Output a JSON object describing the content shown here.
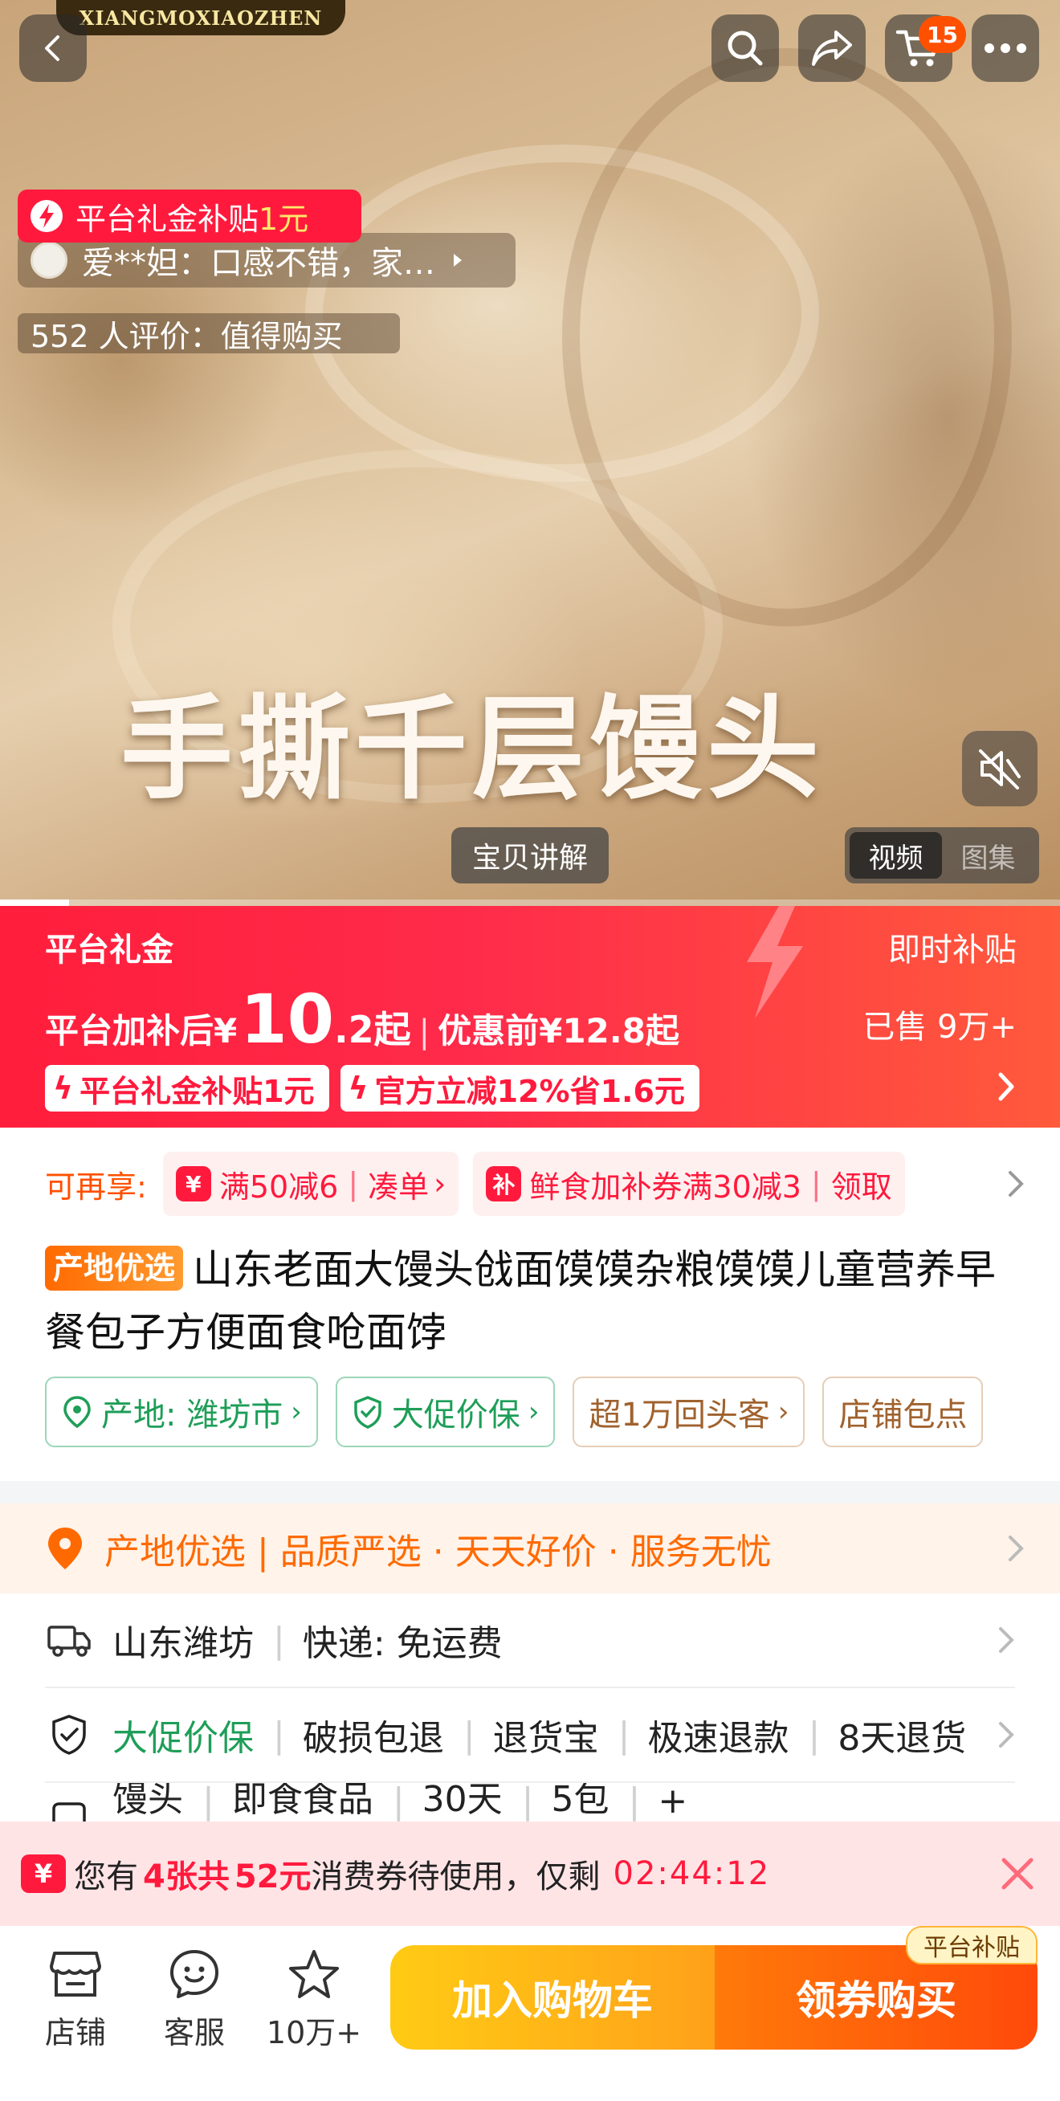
{
  "hero": {
    "brand_text": "XIANGMOXIAOZHEN",
    "cart_count": "15",
    "subsidy_chip": {
      "label": "平台礼金补贴",
      "amount": "1元"
    },
    "review_chip": "爱**妲：口感不错，家…",
    "review_count": "552 人评价：值得购买",
    "overlay_title": "手撕千层馒头",
    "explain_label": "宝贝讲解",
    "media_tabs": [
      "视频",
      "图集"
    ]
  },
  "price_banner": {
    "title": "平台礼金",
    "right_label": "即时补贴",
    "price_label": "平台加补后¥",
    "price_int": "10",
    "price_dec": ".2起",
    "prev_price": "优惠前¥12.8起",
    "sold": "已售 9万+",
    "tags": [
      "平台礼金补贴1元",
      "官方立减12%省1.6元"
    ]
  },
  "coupons": {
    "label": "可再享:",
    "items": [
      {
        "icon": "¥",
        "text": "满50减6",
        "action": "凑单"
      },
      {
        "icon": "补",
        "text": "鲜食加补券满30减3",
        "action": "领取"
      }
    ]
  },
  "product": {
    "badge": "产地优选",
    "title": "山东老面大馒头戗面馍馍杂粮馍馍儿童营养早餐包子方便面食呛面饽"
  },
  "service_tags": [
    "产地: 潍坊市",
    "大促价保",
    "超1万回头客",
    "店铺包点"
  ],
  "origin_strip": "产地优选 | 品质严选 · 天天好价 · 服务无忧",
  "info": {
    "shipping": {
      "from": "山东潍坊",
      "method": "快递: 免运费"
    },
    "guarantee": {
      "highlight": "大促价保",
      "items": [
        "破损包退",
        "退货宝",
        "极速退款",
        "8天退货"
      ]
    },
    "spec": {
      "items": [
        "馒头",
        "即食食品",
        "30天",
        "5包",
        "+"
      ]
    }
  },
  "voucher": {
    "prefix": "您有",
    "count": "4张共",
    "amount": "52元",
    "suffix": "消费券待使用，仅剩",
    "timer": "02:44:12"
  },
  "bottom_bar": {
    "store": "店铺",
    "service": "客服",
    "favorites": "10万+",
    "cart_button": "加入购物车",
    "buy_button": "领券购买",
    "subsidy_tag": "平台补贴"
  },
  "colors": {
    "accent_red": "#ff1a3d",
    "accent_orange": "#ff5000",
    "green": "#1e9e58"
  }
}
